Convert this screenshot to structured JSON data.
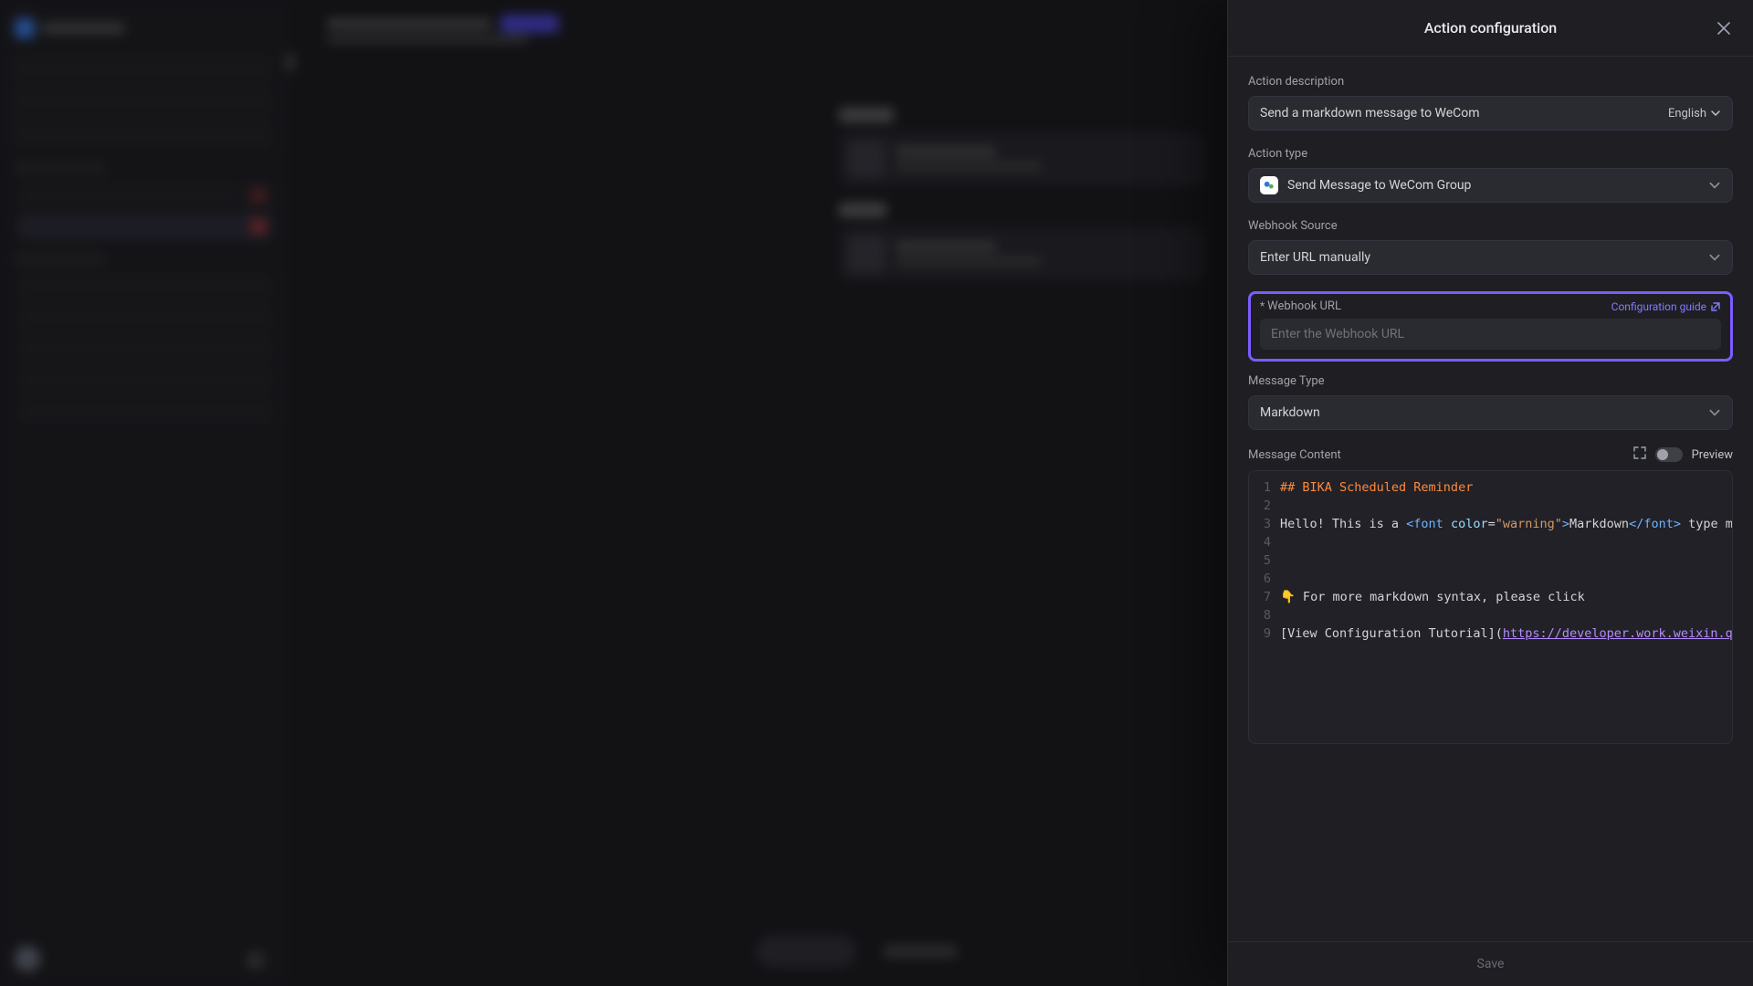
{
  "panel": {
    "title": "Action configuration",
    "close": "×"
  },
  "fields": {
    "desc_label": "Action description",
    "desc_value": "Send a markdown message to WeCom",
    "lang": "English",
    "type_label": "Action type",
    "type_value": "Send Message to WeCom Group",
    "source_label": "Webhook Source",
    "source_value": "Enter URL manually",
    "url_label": "Webhook URL",
    "url_placeholder": "Enter the Webhook URL",
    "cfg_guide": "Configuration guide",
    "msgtype_label": "Message Type",
    "msgtype_value": "Markdown",
    "msgcontent_label": "Message Content",
    "preview": "Preview",
    "save": "Save"
  },
  "code": {
    "lines": [
      {
        "n": 1,
        "html": "<span class='tok-header'>## BIKA Scheduled Reminder</span>"
      },
      {
        "n": 2,
        "html": ""
      },
      {
        "n": 3,
        "html": "<span class='tok-txt'>Hello! This is a </span><span class='tok-tag'>&lt;font</span> <span class='tok-attr'>color</span>=<span class='tok-str'>\"warning\"</span><span class='tok-tag'>&gt;</span><span class='tok-txt'>Markdown</span><span class='tok-tag'>&lt;/font&gt;</span> <span class='tok-txt'>type message</span>"
      },
      {
        "n": 4,
        "html": ""
      },
      {
        "n": 5,
        "html": ""
      },
      {
        "n": 6,
        "html": ""
      },
      {
        "n": 7,
        "html": "<span class='tok-txt'>👇 For more markdown syntax, please click</span>"
      },
      {
        "n": 8,
        "html": ""
      },
      {
        "n": 9,
        "html": "<span class='tok-txt'>[View Configuration Tutorial](</span><span class='tok-url'>https://developer.work.weixin.qq.com</span>"
      }
    ]
  }
}
